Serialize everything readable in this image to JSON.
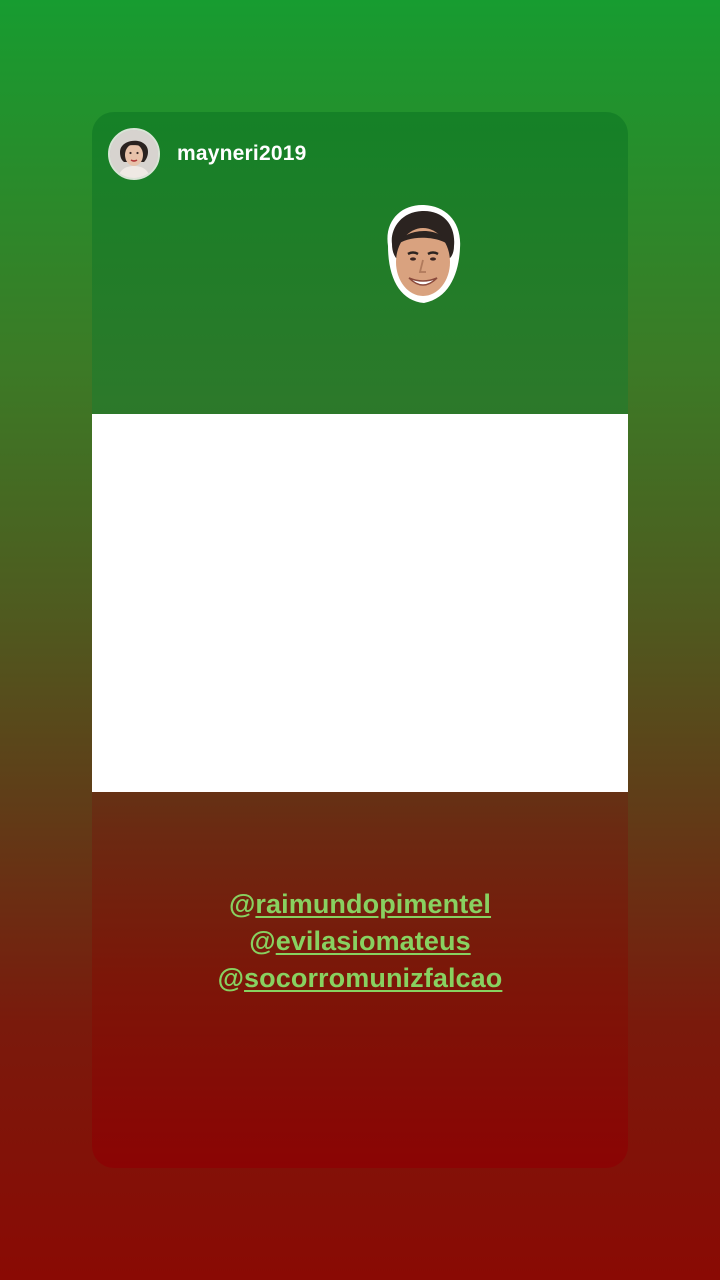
{
  "story": {
    "username": "mayneri2019",
    "mentions": [
      {
        "at": "@",
        "handle": "raimundopimentel"
      },
      {
        "at": "@",
        "handle": "evilasiomateus"
      },
      {
        "at": "@",
        "handle": "socorromunizfalcao"
      }
    ]
  },
  "colors": {
    "green": "#179c30",
    "white": "#ffffff",
    "red": "#8a0a04",
    "mention_text": "#88d160"
  },
  "icons": {
    "avatar": "profile-photo-avatar",
    "sticker": "face-sticker"
  }
}
